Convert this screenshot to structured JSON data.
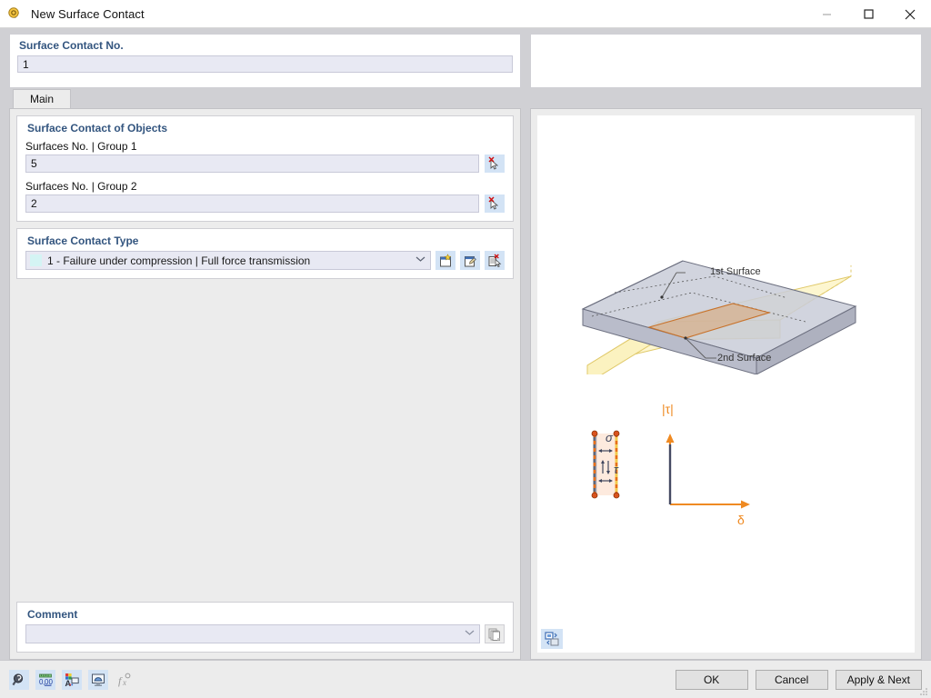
{
  "window": {
    "title": "New Surface Contact",
    "icon": "surface-contact-icon",
    "minimize": "—",
    "maximize": "☐",
    "close": "✕"
  },
  "header": {
    "group_label": "Surface Contact No.",
    "number_value": "1"
  },
  "tabs": [
    {
      "label": "Main",
      "active": true
    }
  ],
  "objects_group": {
    "title": "Surface Contact of Objects",
    "group1_label": "Surfaces No. | Group 1",
    "group1_value": "5",
    "group1_pick_icon": "pick-surface-icon",
    "group2_label": "Surfaces No. | Group 2",
    "group2_value": "2",
    "group2_pick_icon": "pick-surface-icon"
  },
  "contact_type_group": {
    "title": "Surface Contact Type",
    "selected": "1 - Failure under compression | Full force transmission",
    "swatch_color": "#d4f4f4",
    "chevron": "⌄",
    "buttons": [
      {
        "name": "new-contact-type-button",
        "icon": "new-document-icon"
      },
      {
        "name": "edit-contact-type-button",
        "icon": "edit-document-icon"
      },
      {
        "name": "delete-contact-type-button",
        "icon": "delete-document-icon"
      }
    ]
  },
  "comment_group": {
    "title": "Comment",
    "value": "",
    "placeholder": "",
    "chevron": "⌄",
    "copy_icon": "copy-pages-icon"
  },
  "right_panel": {
    "view_toggle_icon": "view-toggle-icon",
    "diagram3d": {
      "label_first": "1st Surface",
      "label_second": "2nd Surface",
      "first_surface_color": "#c9ccd8",
      "second_surface_color": "#fdf6cf",
      "contact_area_color": "#d9a06a"
    },
    "diagram_graph": {
      "y_axis_label": "|τ|",
      "x_axis_label": "δ",
      "sigma_label": "σ",
      "tau_label": "τ",
      "axis_color": "#ef8a22",
      "curve_color": "#454a62"
    }
  },
  "toolbar": {
    "buttons": [
      {
        "name": "search-tool-button",
        "icon": "magnifier-icon",
        "enabled": true
      },
      {
        "name": "units-tool-button",
        "icon": "decimal-places-icon",
        "enabled": true
      },
      {
        "name": "display-properties-button",
        "icon": "colors-icon",
        "enabled": true
      },
      {
        "name": "visibility-button",
        "icon": "monitor-icon",
        "enabled": true
      },
      {
        "name": "formula-button",
        "icon": "function-icon",
        "enabled": false
      }
    ]
  },
  "dialog_buttons": {
    "ok": "OK",
    "cancel": "Cancel",
    "apply_next": "Apply & Next"
  }
}
